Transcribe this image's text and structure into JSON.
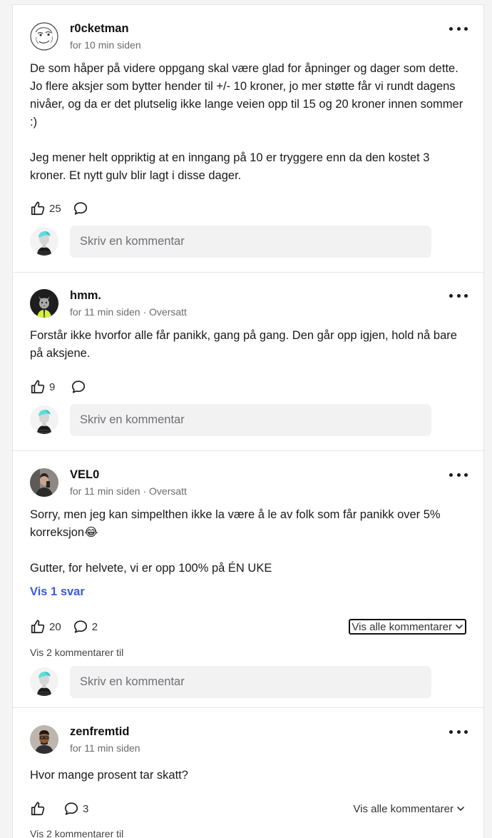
{
  "placeholders": {
    "comment": "Skriv en kommentar"
  },
  "posts": [
    {
      "author": "r0cketman",
      "time": "for 10 min siden",
      "translated": "",
      "paragraphs": [
        "De som håper på videre oppgang skal være glad for åpninger og dager som dette. Jo flere aksjer som bytter hender til +/- 10 kroner, jo mer støtte får vi rundt dagens nivåer, og da er det plutselig ikke lange veien opp til 15 og 20 kroner innen sommer :)",
        "Jeg mener helt oppriktig at en inngang på 10 er tryggere enn da den kostet 3 kroner. Et nytt gulv blir lagt i disse dager."
      ],
      "likes": "25",
      "comments": ""
    },
    {
      "author": "hmm.",
      "time": "for 11 min siden",
      "translated": "Oversatt",
      "paragraphs": [
        "Forstår ikke hvorfor alle får panikk, gang på gang. Den går opp igjen, hold nå bare på aksjene."
      ],
      "likes": "9",
      "comments": ""
    },
    {
      "author": "VEL0",
      "time": "for 11 min siden",
      "translated": "Oversatt",
      "paragraphs": [
        "Sorry, men jeg kan simpelthen ikke la være å le av folk som får panikk over 5% korreksjon😂",
        "Gutter, for helvete, vi er opp 100% på ÉN UKE"
      ],
      "replies_link": "Vis 1 svar",
      "likes": "20",
      "comments": "2",
      "show_all": "Vis alle kommentarer",
      "more_comments": "Vis 2 kommentarer til"
    },
    {
      "author": "zenfremtid",
      "time": "for 11 min siden",
      "translated": "",
      "paragraphs": [
        "Hvor mange prosent tar skatt?"
      ],
      "likes": "",
      "comments": "3",
      "show_all": "Vis alle kommentarer",
      "more_comments": "Vis 2 kommentarer til"
    }
  ],
  "colors": {
    "accent_link": "#3b5bdb",
    "text": "#1a1a1a",
    "muted": "#6b6b70",
    "input_bg": "#f2f2f3"
  }
}
